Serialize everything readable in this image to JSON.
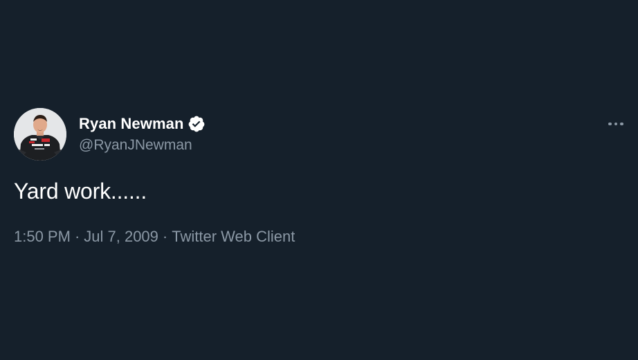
{
  "tweet": {
    "author": {
      "display_name": "Ryan Newman",
      "handle": "@RyanJNewman",
      "verified": true,
      "avatar_icon": "avatar-photo"
    },
    "text": "Yard work......",
    "meta": {
      "time": "1:50 PM",
      "separator": "·",
      "date": "Jul 7, 2009",
      "source": "Twitter Web Client"
    },
    "more_icon": "more-horizontal-icon"
  },
  "colors": {
    "background": "#15202b",
    "primary_text": "#ffffff",
    "secondary_text": "#8b98a5"
  }
}
